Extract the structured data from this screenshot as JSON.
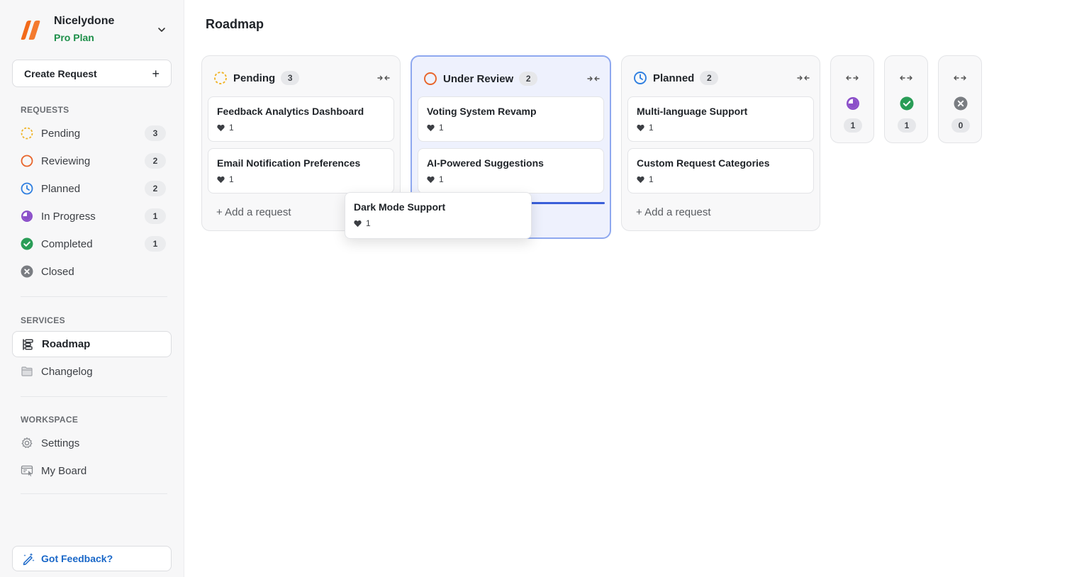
{
  "brand": {
    "name": "Nicelydone",
    "plan": "Pro Plan"
  },
  "sidebar": {
    "create_label": "Create Request",
    "create_plus": "+",
    "sections": {
      "requests": "REQUESTS",
      "services": "SERVICES",
      "workspace": "WORKSPACE"
    },
    "requests": [
      {
        "label": "Pending",
        "count": "3"
      },
      {
        "label": "Reviewing",
        "count": "2"
      },
      {
        "label": "Planned",
        "count": "2"
      },
      {
        "label": "In Progress",
        "count": "1"
      },
      {
        "label": "Completed",
        "count": "1"
      },
      {
        "label": "Closed"
      }
    ],
    "services": [
      {
        "label": "Roadmap"
      },
      {
        "label": "Changelog"
      }
    ],
    "workspace": [
      {
        "label": "Settings"
      },
      {
        "label": "My Board"
      }
    ],
    "feedback_label": "Got Feedback?"
  },
  "main": {
    "title": "Roadmap",
    "add_request_label": "+ Add a request",
    "columns": [
      {
        "title": "Pending",
        "count": "3",
        "cards": [
          {
            "title": "Feedback Analytics Dashboard",
            "votes": "1"
          },
          {
            "title": "Email Notification Preferences",
            "votes": "1"
          }
        ]
      },
      {
        "title": "Under Review",
        "count": "2",
        "cards": [
          {
            "title": "Voting System Revamp",
            "votes": "1"
          },
          {
            "title": "AI-Powered Suggestions",
            "votes": "1"
          }
        ]
      },
      {
        "title": "Planned",
        "count": "2",
        "cards": [
          {
            "title": "Multi-language Support",
            "votes": "1"
          },
          {
            "title": "Custom Request Categories",
            "votes": "1"
          }
        ]
      }
    ],
    "collapsed_columns": [
      {
        "status": "in-progress",
        "count": "1"
      },
      {
        "status": "completed",
        "count": "1"
      },
      {
        "status": "closed",
        "count": "0"
      }
    ],
    "dragging_card": {
      "title": "Dark Mode Support",
      "votes": "1"
    }
  },
  "colors": {
    "pending": "#f0b429",
    "reviewing": "#e8652b",
    "planned": "#2f7fe0",
    "in_progress": "#8b4fc9",
    "completed": "#2a9d57",
    "closed": "#7a7d82",
    "brand_orange": "#f26a1b",
    "plan_green": "#1e8f4a",
    "feedback_blue": "#1967c8",
    "highlight_border": "#8ea8ef"
  }
}
